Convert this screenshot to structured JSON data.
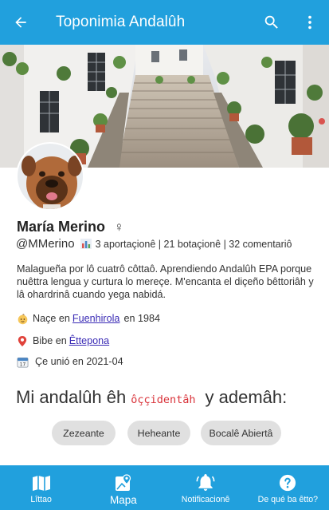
{
  "appbar": {
    "title": "Toponimia Andalûh",
    "back_icon": "arrow-back-icon",
    "search_icon": "search-icon",
    "menu_icon": "more-vert-icon"
  },
  "profile": {
    "name": "María Merino",
    "gender_symbol": "♀",
    "handle": "@MMerino",
    "stats_icon": "bar-chart-icon",
    "stats": "3 aportaçionê | 21 botaçionê | 32 comentariô",
    "bio": "Malagueña por lô cuatrô côttaô. Aprendiendo Andalûh EPA porque nuêttra lengua y curtura lo mereçe. M'encanta el diçeño bêttoriâh y lâ ohardrinâ cuando yega nabidá.",
    "born": {
      "icon": "baby-icon",
      "prefix": "Naçe en",
      "place": "Fuenhirola",
      "suffix": "en 1984"
    },
    "lives": {
      "icon": "pin-icon",
      "prefix": "Bibe en",
      "place": "Êttepona"
    },
    "joined": {
      "icon": "calendar-icon",
      "text": "Çe unió en 2021-04"
    }
  },
  "andaluh": {
    "prefix": "Mi andalûh êh",
    "variant": "ôççidentâh",
    "suffix": "y ademâh:",
    "chips": [
      "Zezeante",
      "Heheante",
      "Bocalê Abiertâ"
    ]
  },
  "nav": [
    {
      "icon": "map-book-icon",
      "label": "Lîttao"
    },
    {
      "icon": "map-pin-icon",
      "label": "Mapa"
    },
    {
      "icon": "bell-icon",
      "label": "Notificacionê"
    },
    {
      "icon": "help-icon",
      "label": "De qué ba êtto?"
    }
  ],
  "colors": {
    "primary": "#21a0dd",
    "chip_bg": "#e0e0e0",
    "link": "#3a2bb5",
    "variant_code": "#d9333a"
  }
}
